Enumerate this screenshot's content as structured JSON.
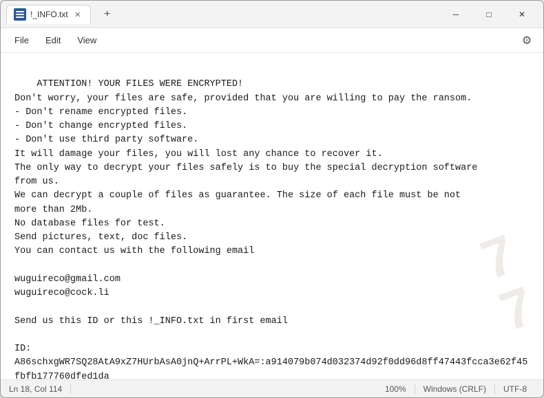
{
  "window": {
    "title": "!_INFO.txt",
    "tab_label": "!_INFO.txt",
    "icon_alt": "notepad-icon"
  },
  "controls": {
    "minimize": "─",
    "maximize": "□",
    "close": "✕",
    "new_tab": "+",
    "tab_close": "✕"
  },
  "menu": {
    "file": "File",
    "edit": "Edit",
    "view": "View",
    "settings_icon": "⚙"
  },
  "content": "ATTENTION! YOUR FILES WERE ENCRYPTED!\nDon't worry, your files are safe, provided that you are willing to pay the ransom.\n- Don't rename encrypted files.\n- Don't change encrypted files.\n- Don't use third party software.\nIt will damage your files, you will lost any chance to recover it.\nThe only way to decrypt your files safely is to buy the special decryption software\nfrom us.\nWe can decrypt a couple of files as guarantee. The size of each file must be not\nmore than 2Mb.\nNo database files for test.\nSend pictures, text, doc files.\nYou can contact us with the following email\n\nwuguireco@gmail.com\nwuguireco@cock.li\n\nSend us this ID or this !_INFO.txt in first email\n\nID:\nA86schxgWR7SQ28AtA9xZ7HUrbAsA0jnQ+ArrPL+WkA=:a914079b074d032374d92f0dd96d8ff47443fcca3e62f45fbfb177760dfed1da",
  "status_bar": {
    "position": "Ln 18, Col 114",
    "zoom": "100%",
    "line_ending": "Windows (CRLF)",
    "encoding": "UTF-8"
  },
  "watermark": {
    "line1": "7",
    "line2": "7"
  }
}
